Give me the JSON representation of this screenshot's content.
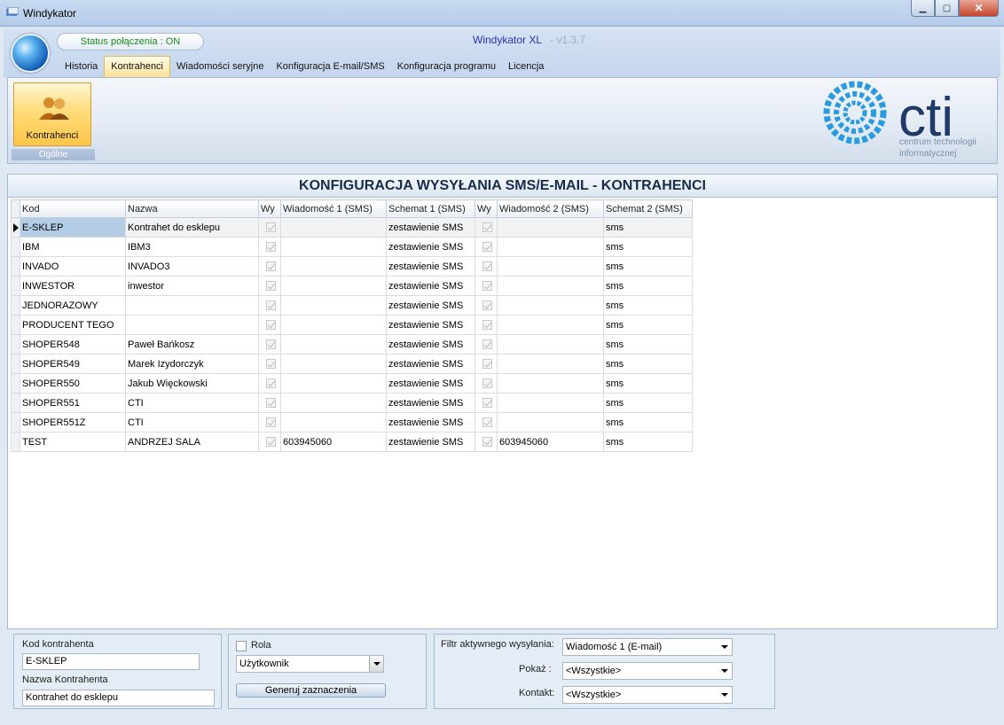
{
  "window": {
    "title": "Windykator"
  },
  "header": {
    "status": "Status połączenia : ON",
    "app_name": "Windykator XL",
    "app_version": "- v1.3.7"
  },
  "menu": [
    "Historia",
    "Kontrahenci",
    "Wiadomości seryjne",
    "Konfiguracja E-mail/SMS",
    "Konfiguracja programu",
    "Licencja"
  ],
  "menu_active": "Kontrahenci",
  "ribbon": {
    "button_label": "Kontrahenci",
    "group_label": "Ogólne",
    "logo_text": "cti",
    "logo_sub1": "centrum technologii",
    "logo_sub2": "informatycznej"
  },
  "main": {
    "heading": "KONFIGURACJA WYSYŁANIA SMS/E-MAIL - KONTRAHENCI"
  },
  "table": {
    "columns": [
      "Kod",
      "Nazwa",
      "Wy",
      "Wiadomość 1 (SMS)",
      "Schemat 1 (SMS)",
      "Wy",
      "Wiadomość 2 (SMS)",
      "Schemat 2 (SMS)"
    ],
    "rows": [
      {
        "kod": "E-SKLEP",
        "nazwa": "Kontrahet do esklepu",
        "wy1": true,
        "wiad1": "",
        "schemat1": "zestawienie SMS",
        "wy2": true,
        "wiad2": "",
        "schemat2": "sms"
      },
      {
        "kod": "IBM",
        "nazwa": "IBM3",
        "wy1": true,
        "wiad1": "",
        "schemat1": "zestawienie SMS",
        "wy2": true,
        "wiad2": "",
        "schemat2": "sms"
      },
      {
        "kod": "INVADO",
        "nazwa": "INVADO3",
        "wy1": true,
        "wiad1": "",
        "schemat1": "zestawienie SMS",
        "wy2": true,
        "wiad2": "",
        "schemat2": "sms"
      },
      {
        "kod": "INWESTOR",
        "nazwa": "inwestor",
        "wy1": true,
        "wiad1": "",
        "schemat1": "zestawienie SMS",
        "wy2": true,
        "wiad2": "",
        "schemat2": "sms"
      },
      {
        "kod": "JEDNORAZOWY",
        "nazwa": "",
        "wy1": true,
        "wiad1": "",
        "schemat1": "zestawienie SMS",
        "wy2": true,
        "wiad2": "",
        "schemat2": "sms"
      },
      {
        "kod": "PRODUCENT TEGO",
        "nazwa": "",
        "wy1": true,
        "wiad1": "",
        "schemat1": "zestawienie SMS",
        "wy2": true,
        "wiad2": "",
        "schemat2": "sms"
      },
      {
        "kod": "SHOPER548",
        "nazwa": "Paweł Bańkosz",
        "wy1": true,
        "wiad1": "",
        "schemat1": "zestawienie SMS",
        "wy2": true,
        "wiad2": "",
        "schemat2": "sms"
      },
      {
        "kod": "SHOPER549",
        "nazwa": "Marek Izydorczyk",
        "wy1": true,
        "wiad1": "",
        "schemat1": "zestawienie SMS",
        "wy2": true,
        "wiad2": "",
        "schemat2": "sms"
      },
      {
        "kod": "SHOPER550",
        "nazwa": "Jakub Więckowski",
        "wy1": true,
        "wiad1": "",
        "schemat1": "zestawienie SMS",
        "wy2": true,
        "wiad2": "",
        "schemat2": "sms"
      },
      {
        "kod": "SHOPER551",
        "nazwa": "CTI",
        "wy1": true,
        "wiad1": "",
        "schemat1": "zestawienie SMS",
        "wy2": true,
        "wiad2": "",
        "schemat2": "sms"
      },
      {
        "kod": "SHOPER551Z",
        "nazwa": "CTI",
        "wy1": true,
        "wiad1": "",
        "schemat1": "zestawienie SMS",
        "wy2": true,
        "wiad2": "",
        "schemat2": "sms"
      },
      {
        "kod": "TEST",
        "nazwa": "ANDRZEJ SALA",
        "wy1": true,
        "wiad1": "603945060",
        "schemat1": "zestawienie SMS",
        "wy2": true,
        "wiad2": "603945060",
        "schemat2": "sms"
      }
    ]
  },
  "details": {
    "kod_label": "Kod kontrahenta",
    "kod_value": "E-SKLEP",
    "nazwa_label": "Nazwa Kontrahenta",
    "nazwa_value": "Kontrahet do esklepu"
  },
  "role": {
    "checkbox_label": "Rola",
    "select_value": "Użytkownik",
    "button_label": "Generuj zaznaczenia"
  },
  "filters": {
    "filtr_label": "Filtr aktywnego wysyłania:",
    "filtr_value": "Wiadomość 1 (E-mail)",
    "pokaz_label": "Pokaż :",
    "pokaz_value": "<Wszystkie>",
    "kontakt_label": "Kontakt:",
    "kontakt_value": "<Wszystkie>"
  }
}
